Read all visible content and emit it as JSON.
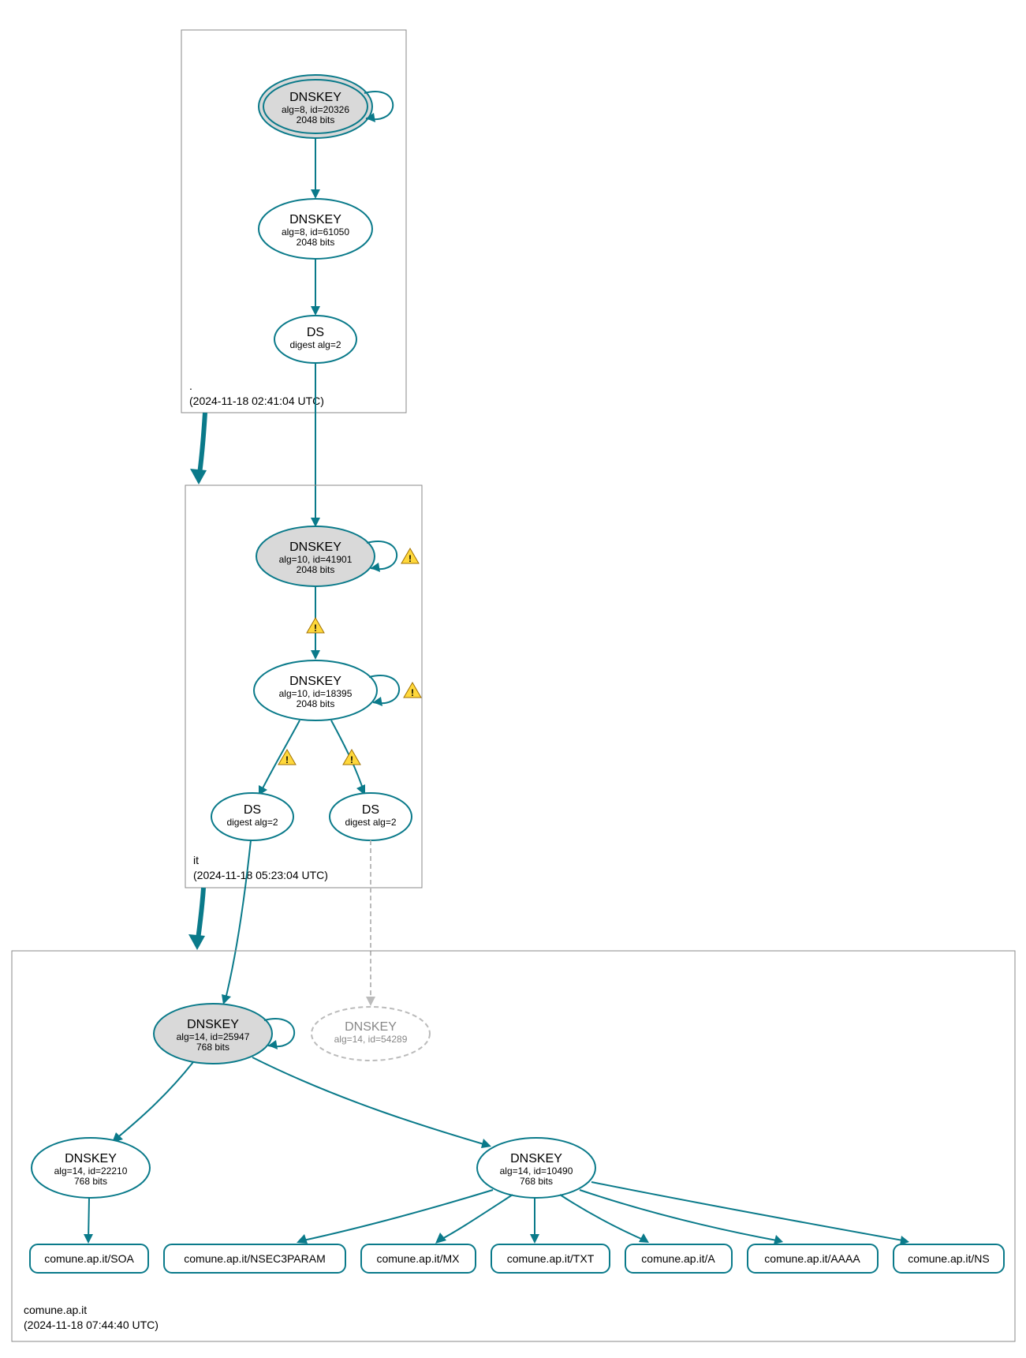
{
  "zones": {
    "root": {
      "name": ".",
      "timestamp": "(2024-11-18 02:41:04 UTC)"
    },
    "it": {
      "name": "it",
      "timestamp": "(2024-11-18 05:23:04 UTC)"
    },
    "comune": {
      "name": "comune.ap.it",
      "timestamp": "(2024-11-18 07:44:40 UTC)"
    }
  },
  "nodes": {
    "root_ksk": {
      "title": "DNSKEY",
      "line1": "alg=8, id=20326",
      "line2": "2048 bits"
    },
    "root_zsk": {
      "title": "DNSKEY",
      "line1": "alg=8, id=61050",
      "line2": "2048 bits"
    },
    "root_ds": {
      "title": "DS",
      "line1": "digest alg=2"
    },
    "it_ksk": {
      "title": "DNSKEY",
      "line1": "alg=10, id=41901",
      "line2": "2048 bits"
    },
    "it_zsk": {
      "title": "DNSKEY",
      "line1": "alg=10, id=18395",
      "line2": "2048 bits"
    },
    "it_ds1": {
      "title": "DS",
      "line1": "digest alg=2"
    },
    "it_ds2": {
      "title": "DS",
      "line1": "digest alg=2"
    },
    "com_ksk": {
      "title": "DNSKEY",
      "line1": "alg=14, id=25947",
      "line2": "768 bits"
    },
    "com_ghost": {
      "title": "DNSKEY",
      "line1": "alg=14, id=54289"
    },
    "com_zsk1": {
      "title": "DNSKEY",
      "line1": "alg=14, id=22210",
      "line2": "768 bits"
    },
    "com_zsk2": {
      "title": "DNSKEY",
      "line1": "alg=14, id=10490",
      "line2": "768 bits"
    },
    "rr_soa": {
      "label": "comune.ap.it/SOA"
    },
    "rr_nsec3": {
      "label": "comune.ap.it/NSEC3PARAM"
    },
    "rr_mx": {
      "label": "comune.ap.it/MX"
    },
    "rr_txt": {
      "label": "comune.ap.it/TXT"
    },
    "rr_a": {
      "label": "comune.ap.it/A"
    },
    "rr_aaaa": {
      "label": "comune.ap.it/AAAA"
    },
    "rr_ns": {
      "label": "comune.ap.it/NS"
    }
  }
}
